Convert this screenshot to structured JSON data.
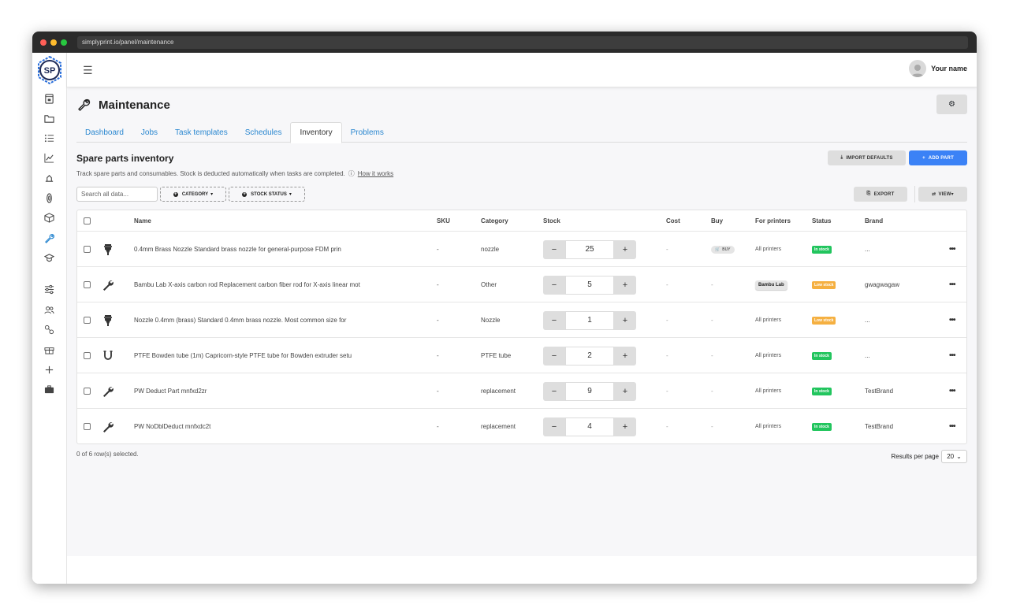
{
  "browser": {
    "url": "simplyprint.io/panel/maintenance"
  },
  "logo": {
    "text": "SP"
  },
  "topbar": {
    "user_name": "Your name"
  },
  "page": {
    "title": "Maintenance"
  },
  "tabs": [
    {
      "label": "Dashboard"
    },
    {
      "label": "Jobs"
    },
    {
      "label": "Task templates"
    },
    {
      "label": "Schedules"
    },
    {
      "label": "Inventory",
      "active": true
    },
    {
      "label": "Problems"
    }
  ],
  "section": {
    "title": "Spare parts inventory",
    "description": "Track spare parts and consumables. Stock is deducted automatically when tasks are completed.",
    "how_link": "How it works"
  },
  "buttons": {
    "import_defaults": "IMPORT DEFAULTS",
    "add_part": "ADD PART",
    "export": "EXPORT",
    "view": "VIEW"
  },
  "filters": {
    "search_placeholder": "Search all data...",
    "category": "CATEGORY",
    "stock_status": "STOCK STATUS"
  },
  "table": {
    "columns": [
      "Name",
      "SKU",
      "Category",
      "Stock",
      "Cost",
      "Buy",
      "For printers",
      "Status",
      "Brand"
    ],
    "rows": [
      {
        "icon": "nozzle-icon",
        "name": "0.4mm Brass Nozzle Standard brass nozzle for general-purpose FDM prin",
        "sku": "-",
        "category": "nozzle",
        "stock": "25",
        "cost": "-",
        "buy": "BUY",
        "printers": "All printers",
        "status": "In stock",
        "status_type": "in",
        "brand": "..."
      },
      {
        "icon": "wrench-icon",
        "name": "Bambu Lab X-axis carbon rod Replacement carbon fiber rod for X-axis linear mot",
        "sku": "-",
        "category": "Other",
        "stock": "5",
        "cost": "-",
        "buy": "-",
        "printers": "Bambu Lab",
        "printers_chip": true,
        "status": "Low stock",
        "status_type": "low",
        "brand": "gwagwagaw"
      },
      {
        "icon": "nozzle-icon",
        "name": "Nozzle 0.4mm (brass) Standard 0.4mm brass nozzle. Most common size for",
        "sku": "-",
        "category": "Nozzle",
        "stock": "1",
        "cost": "-",
        "buy": "-",
        "printers": "All printers",
        "status": "Low stock",
        "status_type": "low",
        "brand": "..."
      },
      {
        "icon": "tube-icon",
        "name": "PTFE Bowden tube (1m) Capricorn-style PTFE tube for Bowden extruder setu",
        "sku": "-",
        "category": "PTFE tube",
        "stock": "2",
        "cost": "-",
        "buy": "-",
        "printers": "All printers",
        "status": "In stock",
        "status_type": "in",
        "brand": "..."
      },
      {
        "icon": "wrench-icon",
        "name": "PW Deduct Part mnfxd2zr",
        "sku": "-",
        "category": "replacement",
        "stock": "9",
        "cost": "-",
        "buy": "-",
        "printers": "All printers",
        "status": "In stock",
        "status_type": "in",
        "brand": "TestBrand"
      },
      {
        "icon": "wrench-icon",
        "name": "PW NoDblDeduct mnfxdc2t",
        "sku": "-",
        "category": "replacement",
        "stock": "4",
        "cost": "-",
        "buy": "-",
        "printers": "All printers",
        "status": "In stock",
        "status_type": "in",
        "brand": "TestBrand"
      }
    ]
  },
  "footer": {
    "selected": "0 of 6 row(s) selected.",
    "results_label": "Results per page",
    "results_value": "20"
  },
  "colors": {
    "accent": "#3b82f6",
    "link": "#2a87d0",
    "in_stock": "#22c55e",
    "low_stock": "#f5b041"
  }
}
